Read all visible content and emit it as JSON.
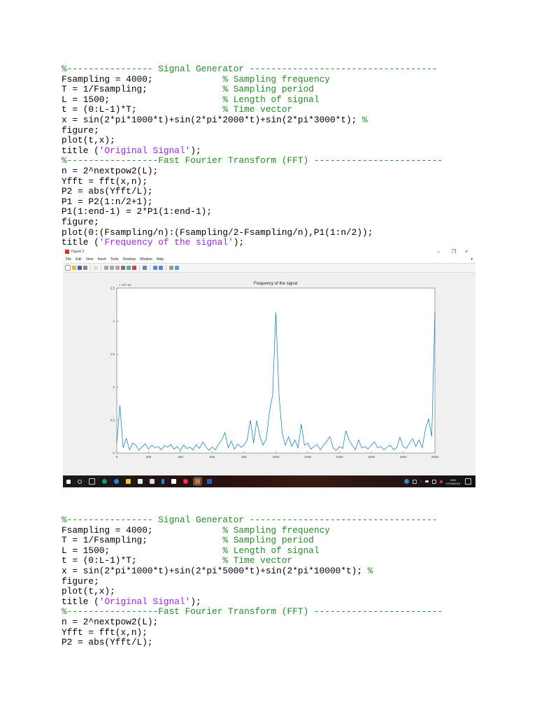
{
  "code_block_1": [
    [
      [
        "%---------------- Signal Generator -----------------------------------",
        "comment"
      ]
    ],
    [
      [
        "Fsampling = 4000;             ",
        "code"
      ],
      [
        "% Sampling frequency",
        "comment"
      ]
    ],
    [
      [
        "T = 1/Fsampling;              ",
        "code"
      ],
      [
        "% Sampling period",
        "comment"
      ]
    ],
    [
      [
        "L = 1500;                     ",
        "code"
      ],
      [
        "% Length of signal",
        "comment"
      ]
    ],
    [
      [
        "t = (0:L-1)*T;                ",
        "code"
      ],
      [
        "% Time vector",
        "comment"
      ]
    ],
    [
      [
        "x = sin(2*pi*1000*t)+sin(2*pi*2000*t)+sin(2*pi*3000*t); ",
        "code"
      ],
      [
        "%",
        "comment"
      ]
    ],
    [
      [
        "figure;",
        "code"
      ]
    ],
    [
      [
        "plot(t,x);",
        "code"
      ]
    ],
    [
      [
        "title (",
        "code"
      ],
      [
        "'Original Signal'",
        "string"
      ],
      [
        ");",
        "code"
      ]
    ],
    [
      [
        "%-----------------Fast Fourier Transform (FFT) ------------------------",
        "comment"
      ]
    ],
    [
      [
        "n = 2^nextpow2(L);",
        "code"
      ]
    ],
    [
      [
        "Yfft = fft(x,n);",
        "code"
      ]
    ],
    [
      [
        "P2 = abs(Yfft/L);",
        "code"
      ]
    ],
    [
      [
        "P1 = P2(1:n/2+1);",
        "code"
      ]
    ],
    [
      [
        "P1(1:end-1) = 2*P1(1:end-1);",
        "code"
      ]
    ],
    [
      [
        "figure;",
        "code"
      ]
    ],
    [
      [
        "plot(0:(Fsampling/n):(Fsampling/2-Fsampling/n),P1(1:n/2));",
        "code"
      ]
    ],
    [
      [
        "title (",
        "code"
      ],
      [
        "'Frequency of the signal'",
        "string"
      ],
      [
        ");",
        "code"
      ]
    ]
  ],
  "code_block_2": [
    [
      [
        "%---------------- Signal Generator -----------------------------------",
        "comment"
      ]
    ],
    [
      [
        "Fsampling = 4000;             ",
        "code"
      ],
      [
        "% Sampling frequency",
        "comment"
      ]
    ],
    [
      [
        "T = 1/Fsampling;              ",
        "code"
      ],
      [
        "% Sampling period",
        "comment"
      ]
    ],
    [
      [
        "L = 1500;                     ",
        "code"
      ],
      [
        "% Length of signal",
        "comment"
      ]
    ],
    [
      [
        "t = (0:L-1)*T;                ",
        "code"
      ],
      [
        "% Time vector",
        "comment"
      ]
    ],
    [
      [
        "x = sin(2*pi*1000*t)+sin(2*pi*5000*t)+sin(2*pi*10000*t); ",
        "code"
      ],
      [
        "%",
        "comment"
      ]
    ],
    [
      [
        "figure;",
        "code"
      ]
    ],
    [
      [
        "plot(t,x);",
        "code"
      ]
    ],
    [
      [
        "title (",
        "code"
      ],
      [
        "'Original Signal'",
        "string"
      ],
      [
        ");",
        "code"
      ]
    ],
    [
      [
        "%-----------------Fast Fourier Transform (FFT) ------------------------",
        "comment"
      ]
    ],
    [
      [
        "n = 2^nextpow2(L);",
        "code"
      ]
    ],
    [
      [
        "Yfft = fft(x,n);",
        "code"
      ]
    ],
    [
      [
        "P2 = abs(Yfft/L);",
        "code"
      ]
    ]
  ],
  "figure_window": {
    "title": "Figure 2",
    "minimize": "–",
    "restore": "❐",
    "close": "×",
    "dock": "▾",
    "menu": [
      "File",
      "Edit",
      "View",
      "Insert",
      "Tools",
      "Desktop",
      "Window",
      "Help"
    ]
  },
  "taskbar": {
    "time": "9:50",
    "date": "07/03/2019"
  },
  "colors": {
    "comment": "#228b22",
    "string": "#a020f0",
    "line": "#0072bd"
  },
  "chart_data": {
    "type": "line",
    "title": "Frequency of the signal",
    "xlabel": "",
    "ylabel": "",
    "y_exponent": "× 10^-13",
    "xlim": [
      0,
      2000
    ],
    "ylim": [
      0,
      2.5
    ],
    "xticks": [
      "0",
      "200",
      "400",
      "600",
      "800",
      "1000",
      "1200",
      "1400",
      "1600",
      "1800",
      "2000"
    ],
    "yticks": [
      "0",
      "0.5",
      "1",
      "1.5",
      "2",
      "2.5"
    ],
    "x_step": 20,
    "values": [
      0.15,
      0.72,
      0.08,
      0.22,
      0.05,
      0.15,
      0.12,
      0.04,
      0.1,
      0.14,
      0.06,
      0.12,
      0.08,
      0.1,
      0.05,
      0.11,
      0.09,
      0.13,
      0.06,
      0.1,
      0.04,
      0.12,
      0.07,
      0.09,
      0.05,
      0.13,
      0.07,
      0.17,
      0.1,
      0.04,
      0.09,
      0.05,
      0.14,
      0.2,
      0.31,
      0.08,
      0.18,
      0.06,
      0.14,
      0.09,
      0.12,
      0.2,
      0.5,
      0.15,
      0.49,
      0.25,
      0.12,
      0.22,
      0.63,
      0.88,
      2.13,
      0.87,
      0.3,
      0.12,
      0.25,
      0.1,
      0.2,
      0.08,
      0.44,
      0.12,
      0.15,
      0.06,
      0.1,
      0.13,
      0.05,
      0.12,
      0.18,
      0.25,
      0.08,
      0.04,
      0.1,
      0.07,
      0.34,
      0.2,
      0.12,
      0.05,
      0.2,
      0.08,
      0.1,
      0.06,
      0.12,
      0.17,
      0.08,
      0.1,
      0.05,
      0.09,
      0.12,
      0.05,
      0.08,
      0.24,
      0.1,
      0.07,
      0.15,
      0.22,
      0.1,
      0.2,
      0.08,
      0.35,
      0.52,
      0.25,
      2.13
    ]
  }
}
